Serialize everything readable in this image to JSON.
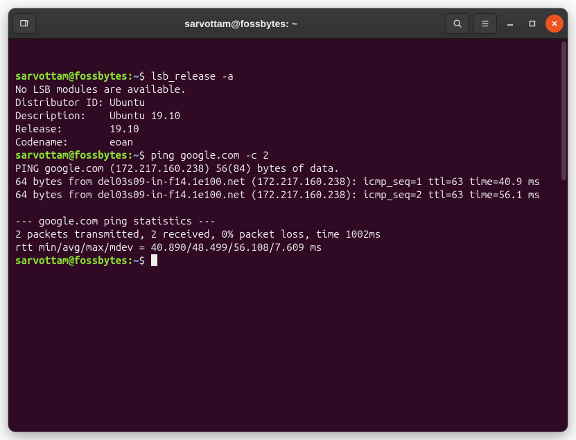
{
  "titlebar": {
    "title": "sarvottam@fossbytes: ~"
  },
  "prompt": {
    "userhost": "sarvottam@fossbytes",
    "sep": ":",
    "path": "~",
    "symbol": "$"
  },
  "lines": {
    "cmd1": "lsb_release -a",
    "out1": "No LSB modules are available.",
    "out2": "Distributor ID: Ubuntu",
    "out3": "Description:    Ubuntu 19.10",
    "out4": "Release:        19.10",
    "out5": "Codename:       eoan",
    "cmd2": "ping google.com -c 2",
    "out6": "PING google.com (172.217.160.238) 56(84) bytes of data.",
    "out7": "64 bytes from del03s09-in-f14.1e100.net (172.217.160.238): icmp_seq=1 ttl=63 time=40.9 ms",
    "out8": "64 bytes from del03s09-in-f14.1e100.net (172.217.160.238): icmp_seq=2 ttl=63 time=56.1 ms",
    "out9": "",
    "out10": "--- google.com ping statistics ---",
    "out11": "2 packets transmitted, 2 received, 0% packet loss, time 1002ms",
    "out12": "rtt min/avg/max/mdev = 40.890/48.499/56.108/7.609 ms"
  }
}
